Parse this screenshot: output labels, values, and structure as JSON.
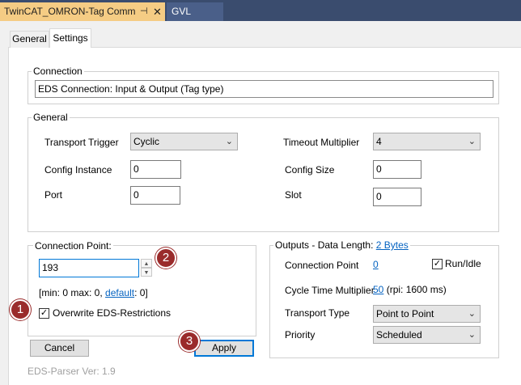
{
  "doc_tabs": {
    "active": "TwinCAT_OMRON-Tag Comm",
    "pin_glyph": "⊣",
    "close_glyph": "✕",
    "other": "GVL"
  },
  "inner_tabs": [
    "General",
    "Settings"
  ],
  "connection": {
    "title": "Connection",
    "value": "EDS Connection: Input & Output (Tag type)"
  },
  "general": {
    "title": "General",
    "transport_trigger_label": "Transport Trigger",
    "transport_trigger_value": "Cyclic",
    "timeout_multiplier_label": "Timeout Multiplier",
    "timeout_multiplier_value": "4",
    "config_instance_label": "Config Instance",
    "config_instance_value": "0",
    "config_size_label": "Config Size",
    "config_size_value": "0",
    "port_label": "Port",
    "port_value": "0",
    "slot_label": "Slot",
    "slot_value": "0"
  },
  "connection_point": {
    "title": "Connection Point:",
    "value": "193",
    "range_prefix": "[min: 0 max: 0,",
    "default_link": "default",
    "range_suffix": ": 0]",
    "overwrite_label": "Overwrite EDS-Restrictions",
    "overwrite_checked": true
  },
  "outputs": {
    "title_prefix": "Outputs - Data Length:",
    "title_link": "2 Bytes",
    "connection_point_label": "Connection Point",
    "connection_point_value": "0",
    "run_idle_label": "Run/Idle",
    "run_idle_checked": true,
    "cycle_time_label": "Cycle Time Multiplier",
    "cycle_time_value": "50",
    "cycle_time_rpi": "(rpi: 1600 ms)",
    "transport_type_label": "Transport Type",
    "transport_type_value": "Point to Point",
    "priority_label": "Priority",
    "priority_value": "Scheduled"
  },
  "buttons": {
    "cancel": "Cancel",
    "apply": "Apply"
  },
  "footer": "EDS-Parser Ver: 1.9",
  "badges": [
    "1",
    "2",
    "3"
  ],
  "icons": {
    "checkmark": "✓",
    "dropdown": "⌄",
    "spin_up": "▲",
    "spin_down": "▼"
  }
}
